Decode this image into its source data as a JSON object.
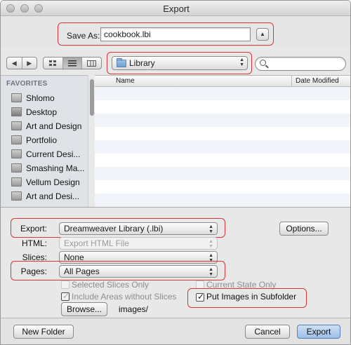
{
  "window": {
    "title": "Export"
  },
  "save_as": {
    "label": "Save As:",
    "value": "cookbook.lbi"
  },
  "toolbar": {
    "back_glyph": "◀",
    "forward_glyph": "▶",
    "view_icons": [
      "icon-view",
      "list-view",
      "column-view"
    ],
    "location": "Library",
    "search_placeholder": ""
  },
  "sidebar": {
    "heading": "FAVORITES",
    "items": [
      {
        "label": "Shlomo",
        "icon": "home-icon"
      },
      {
        "label": "Desktop",
        "icon": "desktop-icon"
      },
      {
        "label": "Art and Design",
        "icon": "folder-icon"
      },
      {
        "label": "Portfolio",
        "icon": "folder-icon"
      },
      {
        "label": "Current Desi...",
        "icon": "folder-icon"
      },
      {
        "label": "Smashing Ma...",
        "icon": "folder-icon"
      },
      {
        "label": "Vellum Design",
        "icon": "folder-icon"
      },
      {
        "label": "Art and Desi...",
        "icon": "folder-icon"
      }
    ]
  },
  "file_list": {
    "columns": [
      "Name",
      "Date Modified"
    ]
  },
  "options": {
    "export": {
      "label": "Export:",
      "value": "Dreamweaver Library (.lbi)"
    },
    "html": {
      "label": "HTML:",
      "value": "Export HTML File"
    },
    "slices": {
      "label": "Slices:",
      "value": "None"
    },
    "pages": {
      "label": "Pages:",
      "value": "All Pages"
    },
    "options_button": "Options...",
    "selected_slices_only": {
      "label": "Selected Slices Only",
      "checked": false,
      "enabled": false
    },
    "current_state_only": {
      "label": "Current State Only",
      "checked": false,
      "enabled": false
    },
    "include_areas": {
      "label": "Include Areas without Slices",
      "checked": true,
      "enabled": false
    },
    "put_images": {
      "label": "Put Images in Subfolder",
      "checked": true,
      "enabled": true
    },
    "browse_button": "Browse...",
    "subfolder_path": "images/"
  },
  "buttons": {
    "new_folder": "New Folder",
    "cancel": "Cancel",
    "export": "Export"
  },
  "colors": {
    "highlight": "#d9353a",
    "default_button": "#9cbfe8"
  }
}
